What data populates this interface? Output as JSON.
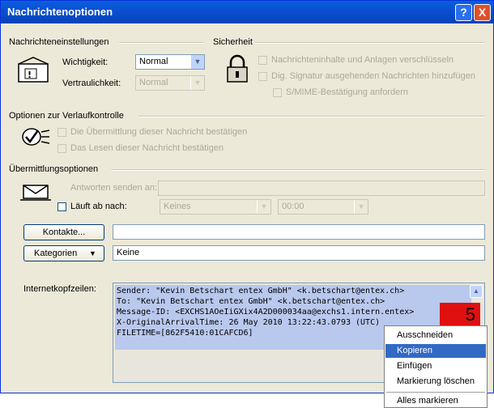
{
  "window": {
    "title": "Nachrichtenoptionen",
    "help_label": "?",
    "close_label": "X"
  },
  "message_settings": {
    "section_label": "Nachrichteneinstellungen",
    "importance_label": "Wichtigkeit:",
    "importance_value": "Normal",
    "sensitivity_label": "Vertraulichkeit:",
    "sensitivity_value": "Normal"
  },
  "security": {
    "section_label": "Sicherheit",
    "encrypt_label": "Nachrichteninhalte und Anlagen verschlüsseln",
    "sign_label": "Dig. Signatur ausgehenden Nachrichten hinzufügen",
    "smime_label": "S/MIME-Bestätigung anfordern"
  },
  "tracking": {
    "section_label": "Optionen zur Verlaufkontrolle",
    "delivery_label": "Die Übermittlung dieser Nachricht bestätigen",
    "read_label": "Das Lesen dieser Nachricht bestätigen"
  },
  "delivery": {
    "section_label": "Übermittlungsoptionen",
    "reply_to_label": "Antworten senden an:",
    "expires_label": "Läuft ab nach:",
    "expires_date": "Keines",
    "expires_time": "00:00"
  },
  "contacts_button": "Kontakte...",
  "categories_button": "Kategorien",
  "categories_value": "Keine",
  "internet_headers": {
    "label": "Internetkopfzeilen:",
    "lines": [
      "Sender: \"Kevin Betschart entex GmbH\" <k.betschart@entex.ch>",
      "To: \"Kevin Betschart entex GmbH\" <k.betschart@entex.ch>",
      "Message-ID: <EXCHS1AOeIiGXix4A2D000034aa@exchs1.intern.entex>",
      "X-OriginalArrivalTime: 26 May 2010 13:22:43.0793 (UTC)",
      "FILETIME=[862F5410:01CAFCD6]"
    ]
  },
  "context_menu": {
    "items": [
      "Ausschneiden",
      "Kopieren",
      "Einfügen",
      "Markierung löschen",
      "Alles markieren"
    ]
  },
  "step_badge": "5",
  "colors": {
    "titlebar": "#0a4fd0",
    "highlight": "#316ac5",
    "badge": "#e01010"
  }
}
